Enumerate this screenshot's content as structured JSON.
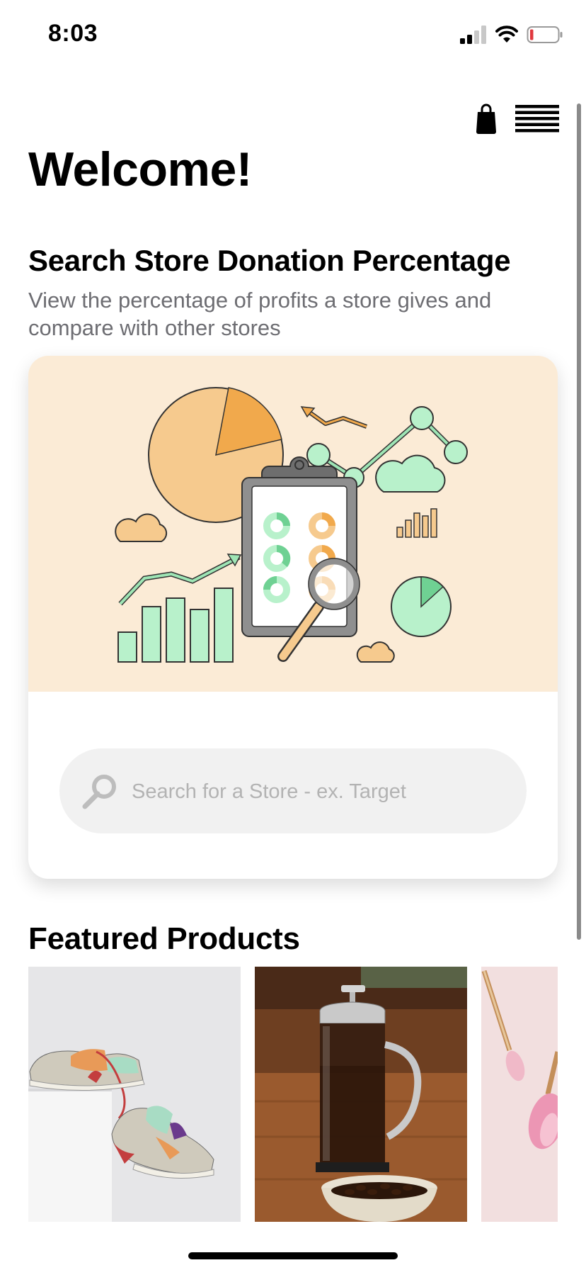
{
  "status_bar": {
    "time": "8:03",
    "signal_bars_active": 2,
    "battery_level": 0.1,
    "battery_color": "#e0383e"
  },
  "header": {
    "icons": [
      "shopping-bag-icon",
      "menu-icon"
    ]
  },
  "welcome": {
    "title": "Welcome!"
  },
  "search_section": {
    "heading": "Search Store Donation Percentage",
    "subtitle": "View the percentage of profits a store gives and compare with other stores",
    "illustration_background": "#fbebd6",
    "search": {
      "placeholder": "Search for a Store - ex. Target",
      "value": ""
    }
  },
  "featured": {
    "heading": "Featured Products",
    "products": [
      {
        "subject": "sneakers"
      },
      {
        "subject": "french-press-coffee"
      },
      {
        "subject": "makeup-brushes"
      }
    ]
  },
  "colors": {
    "accent_mint": "#b8f1cb",
    "accent_orange": "#f5c78a",
    "card_bg": "#fbebd6"
  }
}
